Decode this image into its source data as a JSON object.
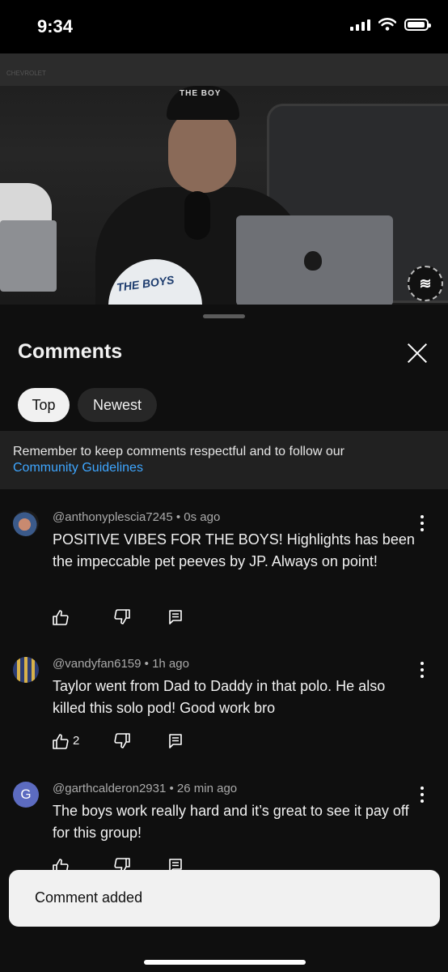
{
  "status_bar": {
    "time": "9:34"
  },
  "video": {
    "hat_text": "THE BOY",
    "cap_text": "THE BOYS",
    "watermark": "CHEVROLET"
  },
  "comments_panel": {
    "title": "Comments",
    "filters": [
      "Top",
      "Newest"
    ],
    "active_filter": "Top",
    "notice": "Remember to keep comments respectful and to follow our",
    "notice_link": "Community Guidelines"
  },
  "comments": [
    {
      "author": "@anthonyplescia7245",
      "time": "0s ago",
      "text": "POSITIVE VIBES FOR THE BOYS! Highlights has been the impeccable pet peeves by JP. Always on point!",
      "likes": ""
    },
    {
      "author": "@vandyfan6159",
      "time": "1h ago",
      "text": "Taylor went from Dad to Daddy in that polo. He also killed this solo pod! Good work bro",
      "likes": "2"
    },
    {
      "author": "@garthcalderon2931",
      "time": "26 min ago",
      "text": "The boys work really hard and it’s great to see it pay off for this group!",
      "avatar_letter": "G",
      "likes": ""
    }
  ],
  "toast": {
    "message": "Comment added"
  }
}
